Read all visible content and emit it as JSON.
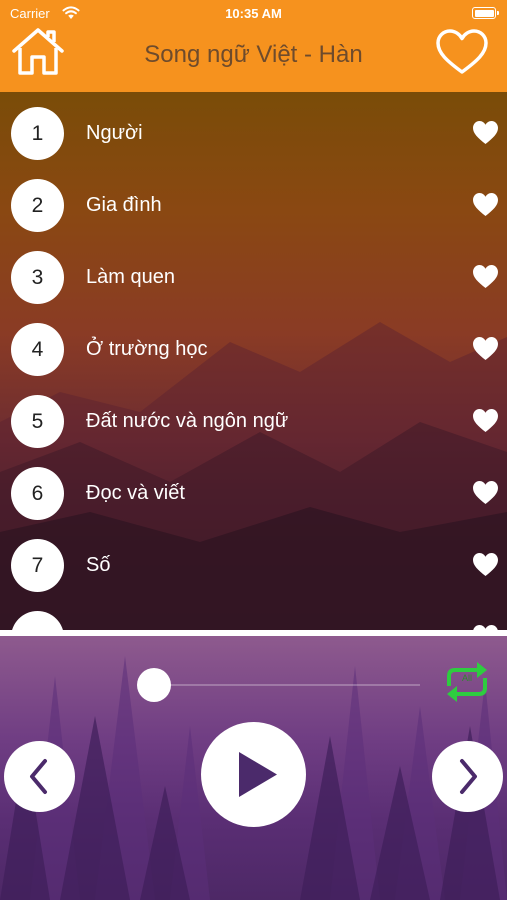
{
  "status_bar": {
    "carrier": "Carrier",
    "time": "10:35 AM"
  },
  "header": {
    "title": "Song ngữ Việt - Hàn",
    "left_icon": "home-icon",
    "right_icon": "heart-outline-icon"
  },
  "songs": [
    {
      "num": "1",
      "title": "Người"
    },
    {
      "num": "2",
      "title": "Gia đình"
    },
    {
      "num": "3",
      "title": "Làm quen"
    },
    {
      "num": "4",
      "title": "Ở trường học"
    },
    {
      "num": "5",
      "title": "Đất nước và ngôn ngữ"
    },
    {
      "num": "6",
      "title": "Đọc và viết"
    },
    {
      "num": "7",
      "title": "Số"
    },
    {
      "num": "",
      "title": ""
    }
  ],
  "player": {
    "repeat_label": "All",
    "progress": 0,
    "controls": [
      "previous-icon",
      "play-icon",
      "next-icon"
    ]
  },
  "colors": {
    "header_bg": "#f6921e",
    "title_text": "#6e4b2c",
    "repeat_icon": "#2ecc40",
    "control_icon": "#4b2a6b"
  }
}
